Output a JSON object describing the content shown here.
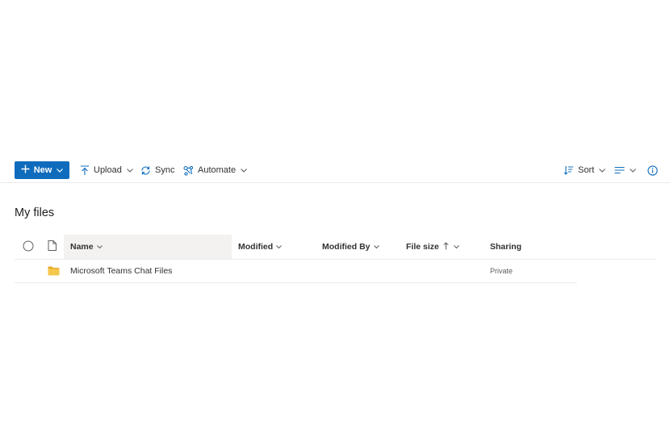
{
  "toolbar": {
    "new_label": "New",
    "upload_label": "Upload",
    "sync_label": "Sync",
    "automate_label": "Automate",
    "sort_label": "Sort"
  },
  "page": {
    "title": "My files"
  },
  "list": {
    "columns": {
      "name": "Name",
      "modified": "Modified",
      "modified_by": "Modified By",
      "file_size": "File size",
      "sharing": "Sharing"
    },
    "rows": [
      {
        "name": "Microsoft Teams Chat Files",
        "modified": "",
        "modified_by": "",
        "file_size": "",
        "sharing": "Private",
        "icon": "folder-icon"
      }
    ]
  },
  "colors": {
    "accent": "#0f6cbd",
    "folder": "#f5c84c",
    "text": "#323130",
    "divider": "#edebe9",
    "header_highlight": "#f3f2f1"
  },
  "icons": [
    "plus-icon",
    "chevron-down-icon",
    "upload-icon",
    "sync-icon",
    "automate-icon",
    "sort-icon",
    "view-options-icon",
    "info-icon",
    "select-all-circle-icon",
    "file-type-icon",
    "sort-ascending-arrow-icon",
    "folder-icon"
  ]
}
